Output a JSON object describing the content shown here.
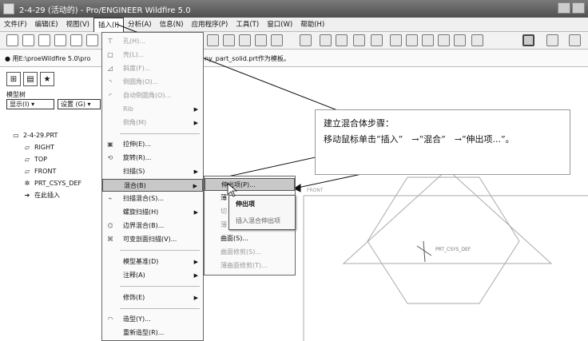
{
  "window": {
    "title": "2-4-29 (活动的) - Pro/ENGINEER Wildfire 5.0"
  },
  "menubar": [
    "文件(F)",
    "编辑(E)",
    "视图(V)",
    "插入(I)",
    "分析(A)",
    "信息(N)",
    "应用程序(P)",
    "工具(T)",
    "窗口(W)",
    "帮助(H)"
  ],
  "message": {
    "left": "● 用E:\\proeWildfire 5.0\\pro",
    "right": "ny_part_solid.prt作为模板。"
  },
  "left_panel": {
    "model_tree_label": "模型树",
    "display_dropdown": "显示(I) ▾",
    "settings_dropdown": "设置 (G) ▾",
    "tree": [
      {
        "icon": "▭",
        "label": "2-4-29.PRT"
      },
      {
        "icon": "▱",
        "label": "RIGHT"
      },
      {
        "icon": "▱",
        "label": "TOP"
      },
      {
        "icon": "▱",
        "label": "FRONT"
      },
      {
        "icon": "✲",
        "label": "PRT_CSYS_DEF"
      },
      {
        "icon": "➔",
        "label": "在此插入"
      }
    ]
  },
  "insert_menu": [
    {
      "label": "孔(H)...",
      "disabled": true,
      "icon": "⊤"
    },
    {
      "label": "壳(L)...",
      "disabled": true,
      "icon": "▢"
    },
    {
      "label": "斜度(F)...",
      "disabled": true,
      "icon": "◿"
    },
    {
      "label": "倒圆角(O)...",
      "disabled": true,
      "icon": "◝"
    },
    {
      "label": "自动倒圆角(O)...",
      "disabled": true,
      "icon": "◜"
    },
    {
      "label": "Rib",
      "disabled": true,
      "icon": "",
      "submenu": true
    },
    {
      "label": "倒角(M)",
      "disabled": true,
      "icon": "",
      "submenu": true
    },
    {
      "label": "拉伸(E)...",
      "disabled": false,
      "icon": "▣"
    },
    {
      "label": "旋转(R)...",
      "disabled": false,
      "icon": "⟲"
    },
    {
      "label": "扫描(S)",
      "disabled": false,
      "icon": "",
      "submenu": true
    },
    {
      "label": "混合(B)",
      "disabled": false,
      "icon": "",
      "submenu": true,
      "highlighted": true
    },
    {
      "label": "扫描混合(S)...",
      "disabled": false,
      "icon": "⌁"
    },
    {
      "label": "螺旋扫描(H)",
      "disabled": false,
      "icon": "",
      "submenu": true
    },
    {
      "label": "边界混合(B)...",
      "disabled": false,
      "icon": "⌬"
    },
    {
      "label": "可变剖面扫描(V)...",
      "disabled": false,
      "icon": "⌘"
    },
    {
      "label": "模型基准(D)",
      "disabled": false,
      "icon": "",
      "submenu": true
    },
    {
      "label": "注释(A)",
      "disabled": false,
      "icon": "",
      "submenu": true
    },
    {
      "label": "修饰(E)",
      "disabled": false,
      "icon": "",
      "submenu": true
    },
    {
      "label": "造型(Y)...",
      "disabled": false,
      "icon": "◠"
    },
    {
      "label": "重新造型(R)...",
      "disabled": false,
      "icon": ""
    }
  ],
  "blend_submenu": [
    {
      "label": "伸出项(P)...",
      "disabled": false,
      "highlighted": true
    },
    {
      "label": "薄",
      "disabled": false
    },
    {
      "label": "切",
      "disabled": true
    },
    {
      "label": "薄",
      "disabled": true
    },
    {
      "label": "曲面(S)...",
      "disabled": false
    },
    {
      "label": "曲面修剪(S)...",
      "disabled": true
    },
    {
      "label": "薄曲面修剪(T)...",
      "disabled": true
    }
  ],
  "tooltip": {
    "title": "伸出项",
    "desc": "插入混合伸出项"
  },
  "annotation": {
    "line1": "建立混合体步骤：",
    "line2": "移动鼠标单击“插入”　→“混合”　→“伸出项...”。"
  },
  "graphics": {
    "front_label": "FRONT",
    "csys_label": "PRT_CSYS_DEF"
  }
}
